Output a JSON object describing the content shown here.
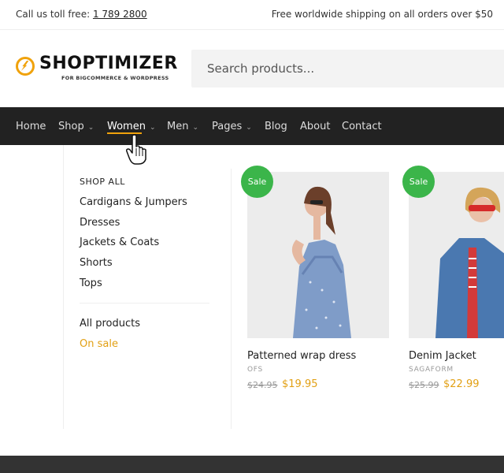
{
  "topbar": {
    "toll_free_label": "Call us toll free:",
    "phone": "1 789 2800",
    "shipping": "Free worldwide shipping on all orders over $50"
  },
  "logo": {
    "name": "SHOPTIMIZER",
    "tagline": "FOR BIGCOMMERCE & WORDPRESS"
  },
  "search": {
    "placeholder": "Search products..."
  },
  "nav": {
    "items": [
      {
        "label": "Home"
      },
      {
        "label": "Shop"
      },
      {
        "label": "Women"
      },
      {
        "label": "Men"
      },
      {
        "label": "Pages"
      },
      {
        "label": "Blog"
      },
      {
        "label": "About"
      },
      {
        "label": "Contact"
      }
    ],
    "active": "Women"
  },
  "mega_menu": {
    "heading": "SHOP ALL",
    "categories": [
      "Cardigans & Jumpers",
      "Dresses",
      "Jackets & Coats",
      "Shorts",
      "Tops"
    ],
    "all_products": "All products",
    "on_sale": "On sale"
  },
  "products": [
    {
      "badge": "Sale",
      "name": "Patterned wrap dress",
      "brand": "OFS",
      "old_price": "$24.95",
      "price": "$19.95"
    },
    {
      "badge": "Sale",
      "name": "Denim Jacket",
      "brand": "SAGAFORM",
      "old_price": "$25.99",
      "price": "$22.99"
    }
  ],
  "colors": {
    "accent": "#f0a20c",
    "sale_badge": "#3bb54a",
    "nav_bg": "#222222",
    "price": "#e2a014"
  }
}
